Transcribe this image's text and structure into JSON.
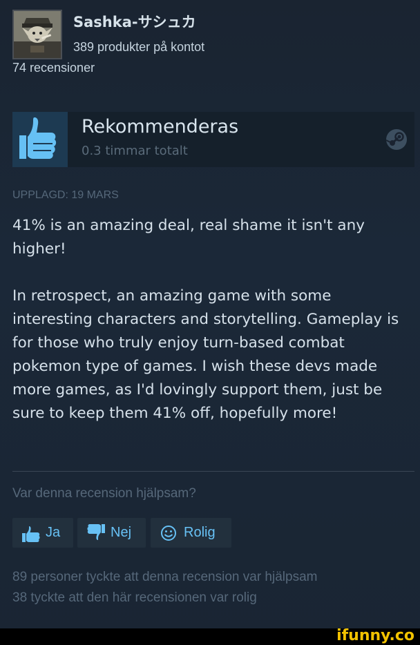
{
  "author": {
    "name": "Sashka-サシュカ",
    "products": "389 produkter på kontot",
    "reviews": "74 recensioner"
  },
  "recommendation": {
    "title": "Rekommenderas",
    "hours": "0.3 timmar totalt",
    "thumb_icon": "thumbs-up-icon",
    "platform_icon": "steam-icon"
  },
  "posted": "UPPLAGD: 19 MARS",
  "review": {
    "paragraphs": [
      "41% is an amazing deal, real shame it isn't any higher!",
      "In retrospect, an amazing game with some interesting characters and storytelling. Gameplay is for those who truly enjoy turn-based combat pokemon type of games. I wish these devs made more games, as I'd lovingly support them, just be sure to keep them 41% off, hopefully more!"
    ]
  },
  "helpful": {
    "question": "Var denna recension hjälpsam?",
    "buttons": {
      "yes": "Ja",
      "no": "Nej",
      "funny": "Rolig"
    },
    "helpful_stat": "89 personer tyckte att denna recension var hjälpsam",
    "funny_stat": "38 tyckte att den här recensionen var rolig"
  },
  "watermark": "ifunny.co",
  "colors": {
    "background": "#1b2838",
    "link": "#67c1f5",
    "muted": "#56687a",
    "thumb_bg": "#1d3a52"
  }
}
